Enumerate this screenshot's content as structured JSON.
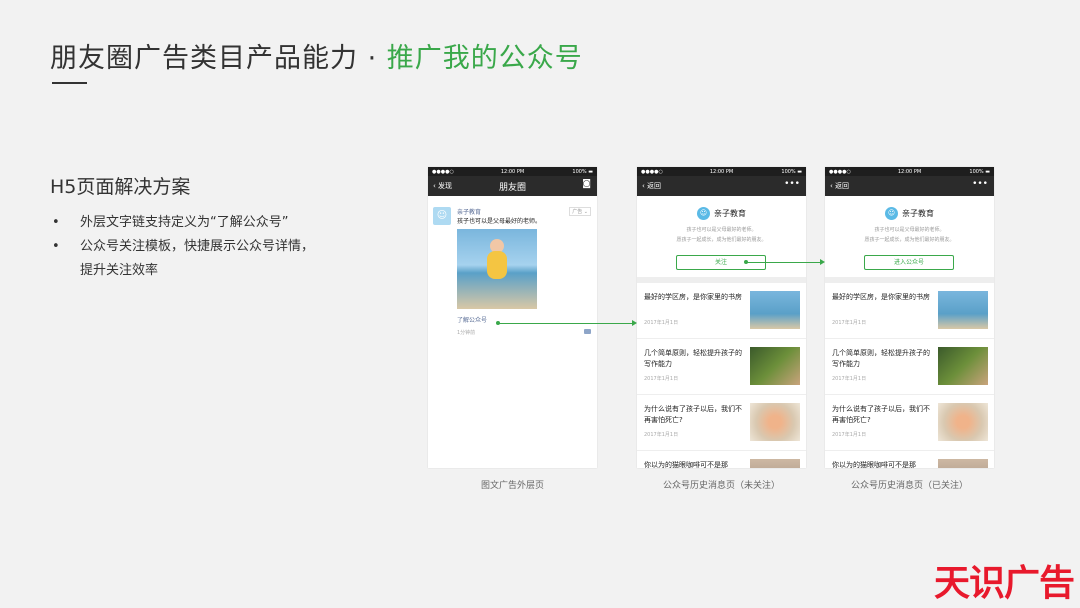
{
  "heading": {
    "main": "朋友圈广告类目产品能力 · ",
    "highlight": "推广我的公众号"
  },
  "section": {
    "title": "H5页面解决方案",
    "bullets": [
      {
        "dot": "•",
        "text": "外层文字链支持定义为“了解公众号”"
      },
      {
        "dot": "•",
        "text": "公众号关注模板，快捷展示公众号详情，"
      },
      {
        "dot": "",
        "text": "提升关注效率"
      }
    ]
  },
  "phone1": {
    "status": {
      "left": "●●●●○",
      "time": "12:00 PM",
      "battery": "100% ▬"
    },
    "nav": {
      "back": "‹ 发现",
      "title": "朋友圈",
      "right": "camera-icon"
    },
    "ad": {
      "name": "亲子教育",
      "text": "孩子也可以是父母最好的老师。",
      "tag": "广告 ⌄",
      "link": "了解公众号",
      "time": "1分钟前"
    },
    "caption": "图文广告外层页"
  },
  "phone2": {
    "status": {
      "left": "●●●●○",
      "time": "12:00 PM",
      "battery": "100% ▬"
    },
    "nav": {
      "back": "‹ 返回",
      "right": "•••"
    },
    "account": {
      "name": "亲子教育",
      "desc1": "孩子也可以是父母最好的老师。",
      "desc2": "愿孩子一起成长，成为他们最好的朋友。",
      "button": "关注"
    },
    "articles": [
      {
        "title": "最好的学区房，是你家里的书房",
        "date": "2017年1月1日"
      },
      {
        "title": "几个简单原则，轻松提升孩子的写作能力",
        "date": "2017年1月1日"
      },
      {
        "title": "为什么说有了孩子以后，我们不再害怕死亡?",
        "date": "2017年1月1日"
      },
      {
        "title": "你以为的猫眼咖啡可不是那",
        "date": ""
      }
    ],
    "caption": "公众号历史消息页（未关注）"
  },
  "phone3": {
    "status": {
      "left": "●●●●○",
      "time": "12:00 PM",
      "battery": "100% ▬"
    },
    "nav": {
      "back": "‹ 返回",
      "right": "•••"
    },
    "account": {
      "name": "亲子教育",
      "desc1": "孩子也可以是父母最好的老师。",
      "desc2": "愿孩子一起成长，成为他们最好的朋友。",
      "button": "进入公众号"
    },
    "articles": [
      {
        "title": "最好的学区房，是你家里的书房",
        "date": "2017年1月1日"
      },
      {
        "title": "几个简单原则，轻松提升孩子的写作能力",
        "date": "2017年1月1日"
      },
      {
        "title": "为什么说有了孩子以后，我们不再害怕死亡?",
        "date": "2017年1月1日"
      },
      {
        "title": "你以为的猫眼咖啡可不是那",
        "date": ""
      }
    ],
    "caption": "公众号历史消息页（已关注）"
  },
  "brand": {
    "logo": "天识广告",
    "accent": "#3aa84a",
    "logo_color": "#e8192c"
  }
}
